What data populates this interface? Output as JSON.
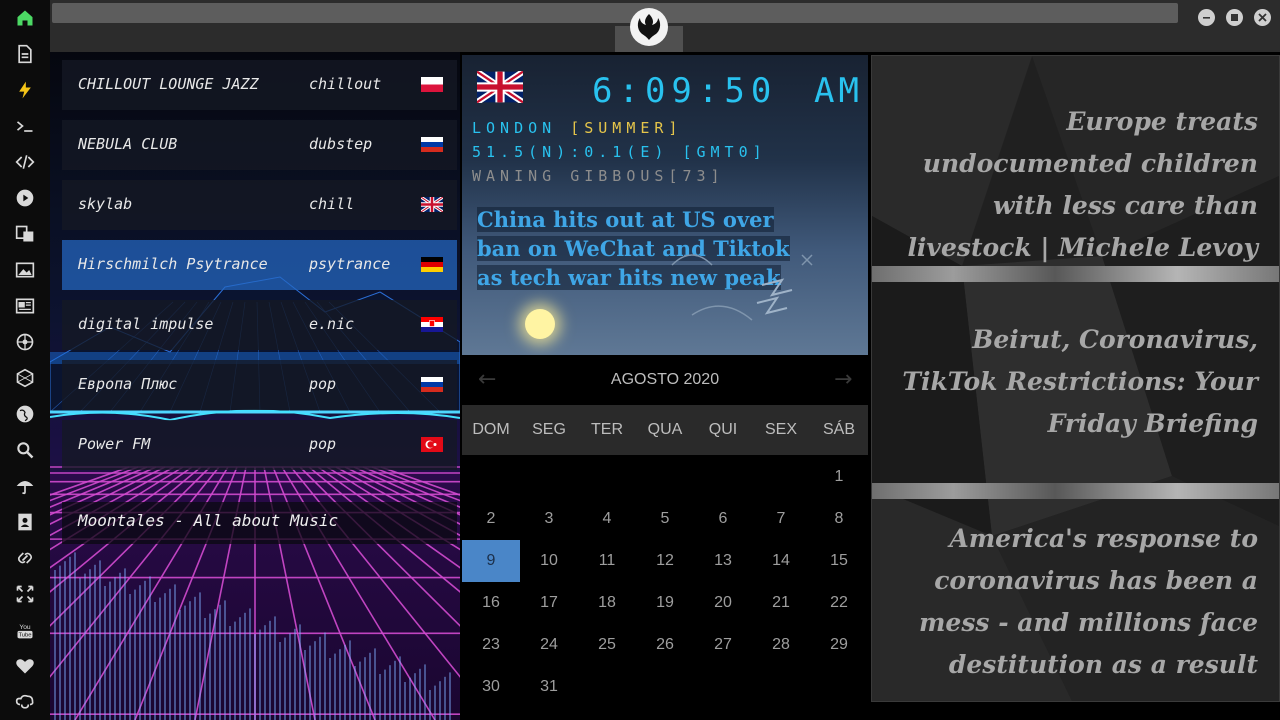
{
  "sidebar": {
    "items": [
      {
        "icon": "home-icon",
        "color": "#4cd964"
      },
      {
        "icon": "document-icon",
        "color": "#d9d9d9"
      },
      {
        "icon": "lightning-icon",
        "color": "#f5c518"
      },
      {
        "icon": "terminal-icon",
        "color": "#d9d9d9"
      },
      {
        "icon": "code-icon",
        "color": "#d9d9d9"
      },
      {
        "icon": "play-icon",
        "color": "#d9d9d9"
      },
      {
        "icon": "translate-icon",
        "color": "#d9d9d9"
      },
      {
        "icon": "image-icon",
        "color": "#d9d9d9"
      },
      {
        "icon": "news-icon",
        "color": "#d9d9d9"
      },
      {
        "icon": "settings-wheel-icon",
        "color": "#d9d9d9"
      },
      {
        "icon": "hexagon-icon",
        "color": "#d9d9d9"
      },
      {
        "icon": "globe-icon",
        "color": "#d9d9d9"
      },
      {
        "icon": "search-icon",
        "color": "#d9d9d9"
      },
      {
        "icon": "umbrella-icon",
        "color": "#d9d9d9"
      },
      {
        "icon": "contact-icon",
        "color": "#d9d9d9"
      },
      {
        "icon": "link-icon",
        "color": "#d9d9d9"
      },
      {
        "icon": "expand-icon",
        "color": "#d9d9d9"
      },
      {
        "icon": "youtube-icon",
        "color": "#d9d9d9"
      },
      {
        "icon": "heart-icon",
        "color": "#d9d9d9"
      },
      {
        "icon": "cloud-link-icon",
        "color": "#d9d9d9"
      }
    ]
  },
  "stations": [
    {
      "name": "CHILLOUT LOUNGE JAZZ",
      "genre": "chillout",
      "flag": "poland"
    },
    {
      "name": "NEBULA CLUB",
      "genre": "dubstep",
      "flag": "russia"
    },
    {
      "name": "skylab",
      "genre": "chill",
      "flag": "uk"
    },
    {
      "name": "Hirschmilch Psytrance",
      "genre": "psytrance",
      "flag": "germany",
      "active": true
    },
    {
      "name": "digital impulse",
      "genre": "e.nic",
      "flag": "croatia"
    },
    {
      "name": "Европа Плюс",
      "genre": "pop",
      "flag": "russia"
    },
    {
      "name": "Power FM",
      "genre": "pop",
      "flag": "turkey"
    }
  ],
  "now_playing": "Moontales - All about Music",
  "clock": {
    "time": "6:09:50",
    "ampm": "AM",
    "city": "LONDON",
    "season": "[SUMMER]",
    "coords": "51.5(N):0.1(E) [GMT0]",
    "moon": "WANING GIBBOUS[73]",
    "headline": "China hits out at US over ban on WeChat and Tiktok as tech war hits new peak",
    "time_color": "#29c2ef",
    "season_color": "#e5c54a"
  },
  "calendar": {
    "title": "AGOSTO 2020",
    "prev_label": "←",
    "next_label": "→",
    "weekdays": [
      "DOM",
      "SEG",
      "TER",
      "QUA",
      "QUI",
      "SEX",
      "SÁB"
    ],
    "days": [
      "1",
      "2",
      "3",
      "4",
      "5",
      "6",
      "7",
      "8",
      "9",
      "10",
      "11",
      "12",
      "13",
      "14",
      "15",
      "16",
      "17",
      "18",
      "19",
      "20",
      "21",
      "22",
      "23",
      "24",
      "25",
      "26",
      "27",
      "28",
      "29",
      "30",
      "31"
    ],
    "first_weekday": 6,
    "today": "9",
    "today_color": "#4a86c8"
  },
  "news": [
    "Europe treats undocumented children with less care than livestock | Michele Levoy",
    "Beirut, Coronavirus, TikTok Restrictions: Your Friday Briefing",
    "America's response to coronavirus has been a mess - and millions face destitution as a result"
  ]
}
